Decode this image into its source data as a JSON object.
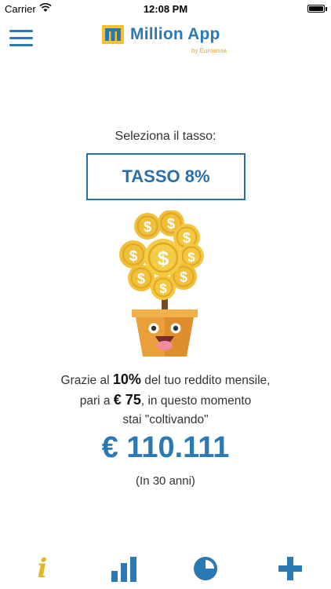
{
  "status_bar": {
    "carrier": "Carrier",
    "time": "12:08 PM"
  },
  "header": {
    "title": "Million App",
    "subtitle": "by Euroansa"
  },
  "main": {
    "select_label": "Seleziona il tasso:",
    "rate_button": "TASSO 8%",
    "description": {
      "part1": "Grazie al ",
      "percent": "10%",
      "part2": " del tuo reddito mensile,",
      "part3": "pari a ",
      "monthly": "€ 75",
      "part4": ", in questo momento",
      "part5": "stai \"coltivando\""
    },
    "amount": "€ 110.111",
    "years_note": "(In 30 anni)"
  },
  "tab_bar": {
    "items": [
      {
        "icon": "info-icon"
      },
      {
        "icon": "bar-chart-icon"
      },
      {
        "icon": "pie-chart-icon"
      },
      {
        "icon": "plus-icon"
      }
    ]
  },
  "colors": {
    "accent": "#2a78b4",
    "gold": "#e8b62a",
    "pot": "#e9a03a"
  }
}
